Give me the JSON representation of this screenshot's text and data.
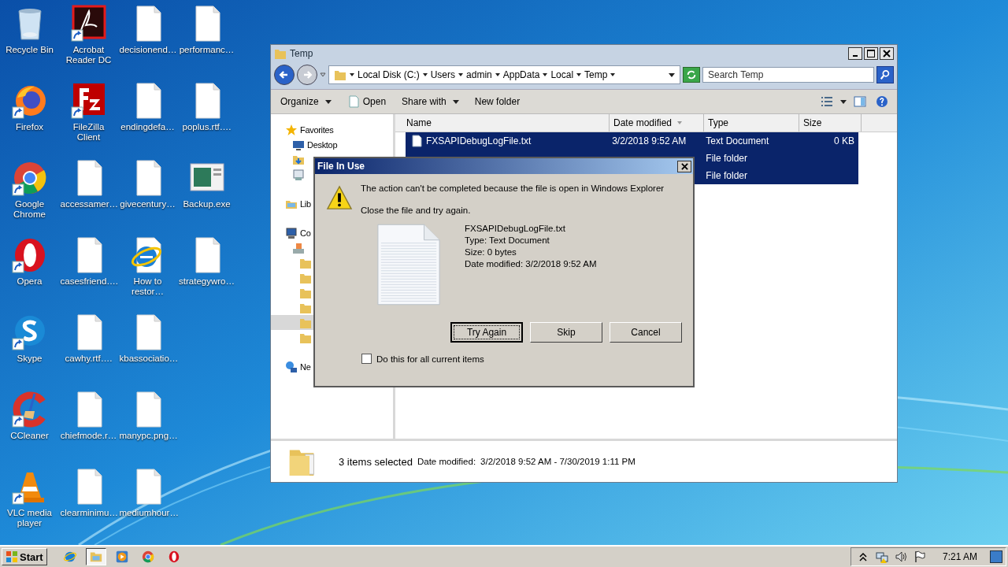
{
  "desktop_icons": [
    {
      "label": "Recycle Bin",
      "kind": "recycle",
      "shortcut": false
    },
    {
      "label": "Firefox",
      "kind": "firefox",
      "shortcut": true
    },
    {
      "label": "Google Chrome",
      "kind": "chrome",
      "shortcut": true
    },
    {
      "label": "Opera",
      "kind": "opera",
      "shortcut": true
    },
    {
      "label": "Skype",
      "kind": "skype",
      "shortcut": true
    },
    {
      "label": "CCleaner",
      "kind": "ccleaner",
      "shortcut": true
    },
    {
      "label": "VLC media player",
      "kind": "vlc",
      "shortcut": true
    },
    {
      "label": "Acrobat Reader DC",
      "kind": "acrobat",
      "shortcut": true
    },
    {
      "label": "FileZilla Client",
      "kind": "filezilla",
      "shortcut": true
    },
    {
      "label": "accessamer…",
      "kind": "file",
      "shortcut": false
    },
    {
      "label": "casesfriend….",
      "kind": "file",
      "shortcut": false
    },
    {
      "label": "cawhy.rtf….",
      "kind": "file",
      "shortcut": false
    },
    {
      "label": "chiefmode.r…",
      "kind": "file",
      "shortcut": false
    },
    {
      "label": "clearminimu…",
      "kind": "file",
      "shortcut": false
    },
    {
      "label": "decisionend…",
      "kind": "file",
      "shortcut": false
    },
    {
      "label": "endingdefa…",
      "kind": "file",
      "shortcut": false
    },
    {
      "label": "givecentury…",
      "kind": "file",
      "shortcut": false
    },
    {
      "label": "How to restor…",
      "kind": "ie",
      "shortcut": false
    },
    {
      "label": "kbassociatio…",
      "kind": "file",
      "shortcut": false
    },
    {
      "label": "manypc.png…",
      "kind": "file",
      "shortcut": false
    },
    {
      "label": "mediumhour…",
      "kind": "file",
      "shortcut": false
    },
    {
      "label": "performanc…",
      "kind": "file",
      "shortcut": false
    },
    {
      "label": "poplus.rtf….",
      "kind": "file",
      "shortcut": false
    },
    {
      "label": "Backup.exe",
      "kind": "exe",
      "shortcut": false
    },
    {
      "label": "strategywro…",
      "kind": "file",
      "shortcut": false
    }
  ],
  "explorer": {
    "title": "Temp",
    "breadcrumbs": [
      "Local Disk (C:)",
      "Users",
      "admin",
      "AppData",
      "Local",
      "Temp"
    ],
    "search": {
      "placeholder": "Search Temp"
    },
    "toolbar": [
      {
        "label": "Organize",
        "kind": "menu"
      },
      {
        "label": "Open",
        "kind": "open"
      },
      {
        "label": "Share with",
        "kind": "menu"
      },
      {
        "label": "New folder",
        "kind": "plain"
      }
    ],
    "nav": [
      {
        "label": "Favorites",
        "kind": "star",
        "selected": false,
        "children": [
          {
            "label": "Desktop",
            "kind": "desktop",
            "selected": false
          },
          {
            "kind": "downloads",
            "selected": false
          },
          {
            "kind": "recent",
            "selected": false
          }
        ]
      },
      {
        "label": "Lib",
        "kind": "libraries",
        "selected": false
      },
      {
        "label": "Co",
        "kind": "computer",
        "selected": false,
        "children": [
          {
            "kind": "drive",
            "selected": false,
            "children": [
              {
                "kind": "folder",
                "selected": false
              },
              {
                "kind": "folder",
                "selected": false
              },
              {
                "kind": "folder",
                "selected": false
              },
              {
                "kind": "folder",
                "selected": false
              },
              {
                "kind": "folder",
                "selected": true
              },
              {
                "kind": "folder",
                "selected": false
              }
            ]
          }
        ]
      },
      {
        "label": "Ne",
        "kind": "network",
        "selected": false
      }
    ],
    "columns": [
      {
        "label": "Name",
        "sorted": false
      },
      {
        "label": "Date modified",
        "sorted": true
      },
      {
        "label": "Type",
        "sorted": false
      },
      {
        "label": "Size",
        "sorted": false
      }
    ],
    "rows": [
      {
        "name": "FXSAPIDebugLogFile.txt",
        "date": "3/2/2018 9:52 AM",
        "type": "Text Document",
        "size": "0 KB",
        "selected": true
      },
      {
        "type": "File folder",
        "selected": true
      },
      {
        "type": "File folder",
        "selected": true
      }
    ],
    "status": {
      "count": "3 items selected",
      "label": "Date modified:",
      "value": "3/2/2018 9:52 AM - 7/30/2019 1:11 PM"
    }
  },
  "dialog": {
    "title": "File In Use",
    "message": "The action can't be completed because the file is open in Windows Explorer",
    "hint": "Close the file and try again.",
    "file": {
      "name": "FXSAPIDebugLogFile.txt",
      "type": "Type: Text Document",
      "size": "Size: 0 bytes",
      "date": "Date modified: 3/2/2018 9:52 AM"
    },
    "buttons": [
      {
        "label": "Try Again",
        "default": true
      },
      {
        "label": "Skip",
        "default": false
      },
      {
        "label": "Cancel",
        "default": false
      }
    ],
    "checkbox": {
      "label": "Do this for all current items",
      "checked": false
    }
  },
  "taskbar": {
    "start": "Start",
    "apps": [
      {
        "kind": "ie",
        "selected": false
      },
      {
        "kind": "explorer",
        "selected": true
      },
      {
        "kind": "media",
        "selected": false
      },
      {
        "kind": "chrome",
        "selected": false
      },
      {
        "kind": "opera",
        "selected": false
      }
    ],
    "tray": [
      {
        "kind": "chevron"
      },
      {
        "kind": "network"
      },
      {
        "kind": "volume"
      },
      {
        "kind": "flag"
      }
    ],
    "time": "7:21 AM"
  }
}
